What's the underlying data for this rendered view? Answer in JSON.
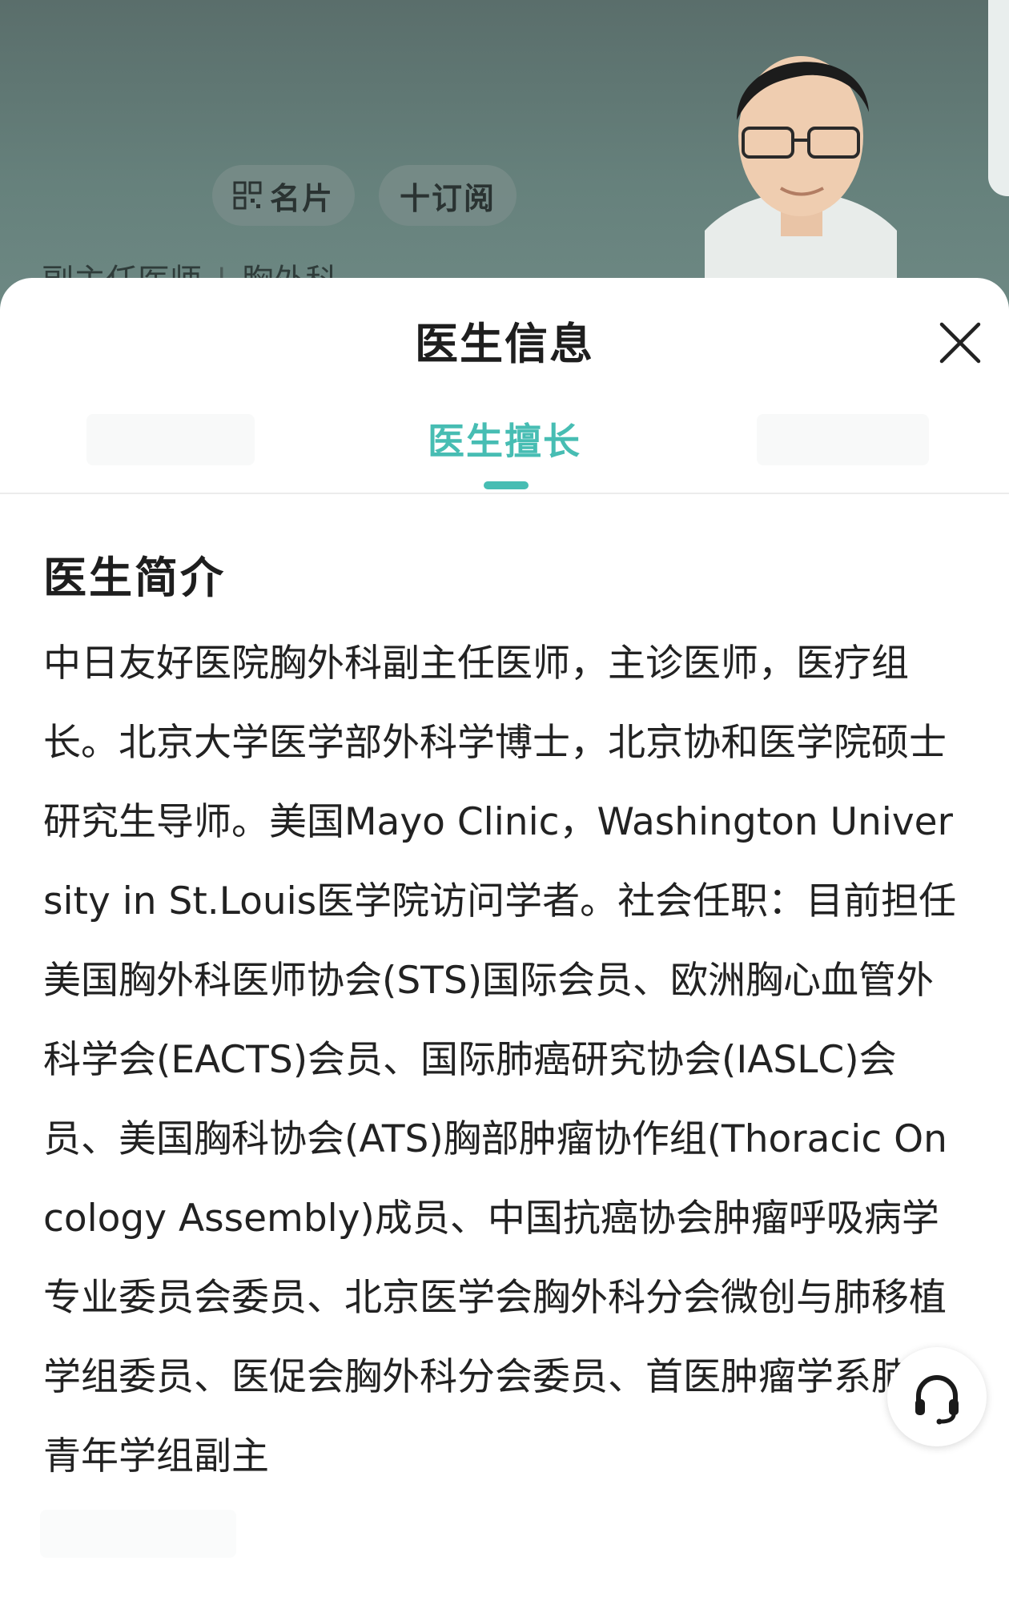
{
  "header": {
    "card_button_label": "名片",
    "subscribe_button_label": "十订阅",
    "doctor_title": "副主任医师",
    "department": "胸外科"
  },
  "sheet": {
    "title": "医生信息",
    "tabs": {
      "active_label": "医生擅长"
    },
    "section_title": "医生简介",
    "intro_text": "中日友好医院胸外科副主任医师，主诊医师，医疗组长。北京大学医学部外科学博士，北京协和医学院硕士研究生导师。美国Mayo Clinic，Washington University in St.Louis医学院访问学者。社会任职：目前担任美国胸外科医师协会(STS)国际会员、欧洲胸心血管外科学会(EACTS)会员、国际肺癌研究协会(IASLC)会员、美国胸科协会(ATS)胸部肿瘤协作组(Thoracic Oncology Assembly)成员、中国抗癌协会肿瘤呼吸病学专业委员会委员、北京医学会胸外科分会微创与肺移植学组委员、医促会胸外科分会委员、首医肿瘤学系肺癌青年学组副主"
  },
  "colors": {
    "accent": "#47bdb3",
    "header_bg": "#66817c",
    "text": "#222222"
  },
  "icons": {
    "close": "close-icon",
    "qr": "qr-code-icon",
    "service": "headset-icon"
  }
}
